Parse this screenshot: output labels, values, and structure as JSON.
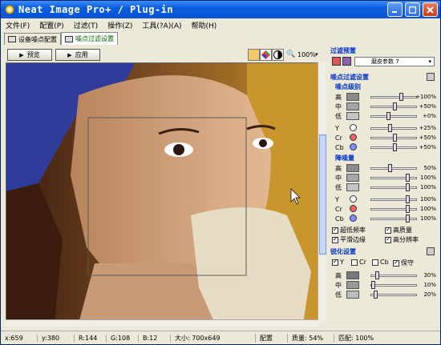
{
  "window": {
    "title": "Neat Image Pro+ / Plug-in"
  },
  "menu": [
    "文件(F)",
    "配置(P)",
    "过滤(T)",
    "操作(Z)",
    "工具(?A)(A)",
    "帮助(H)"
  ],
  "tabs": [
    "设备噪点配置",
    "噪点过滤设置"
  ],
  "toolbar": {
    "preview_label": "预览",
    "apply_label": "应用",
    "zoom": "100%"
  },
  "panel": {
    "preset_header": "过滤预置",
    "preset_value": "磨皮参数 7",
    "noise_filter_header": "噪点过滤设置",
    "noise_level_header": "噪点级别",
    "noise_level_rows": [
      {
        "label": "高",
        "value": "+100%"
      },
      {
        "label": "中",
        "value": "+50%"
      },
      {
        "label": "低",
        "value": "+0%"
      }
    ],
    "noise_level_channels": [
      {
        "label": "Y",
        "value": "+25%"
      },
      {
        "label": "Cr",
        "value": "+50%"
      },
      {
        "label": "Cb",
        "value": "+50%"
      }
    ],
    "reduction_header": "降噪量",
    "reduction_rows": [
      {
        "label": "高",
        "value": "50%"
      },
      {
        "label": "中",
        "value": "100%"
      },
      {
        "label": "低",
        "value": "100%"
      }
    ],
    "reduction_channels": [
      {
        "label": "Y",
        "value": "100%"
      },
      {
        "label": "Cr",
        "value": "100%"
      },
      {
        "label": "Cb",
        "value": "100%"
      }
    ],
    "options": [
      {
        "label": "超低频率",
        "checked": true
      },
      {
        "label": "高质量",
        "checked": true
      },
      {
        "label": "平滑边缘",
        "checked": true
      },
      {
        "label": "高分辨率",
        "checked": true
      }
    ],
    "sharpen_header": "锐化设置",
    "sharpen_channels": [
      {
        "label": "Y",
        "checked": true
      },
      {
        "label": "Cr",
        "checked": false
      },
      {
        "label": "Cb",
        "checked": false
      },
      {
        "label": "保守",
        "checked": true
      }
    ],
    "sharpen_rows": [
      {
        "label": "高",
        "value": "30%"
      },
      {
        "label": "中",
        "value": "10%"
      },
      {
        "label": "低",
        "value": "20%"
      }
    ]
  },
  "status": {
    "x": "x:659",
    "y": "y:380",
    "r": "R:144",
    "g": "G:108",
    "b": "B:12",
    "size": "大小: 700x649",
    "profile": "配置",
    "quality": "质量: 54%",
    "match": "匹配: 100%"
  }
}
